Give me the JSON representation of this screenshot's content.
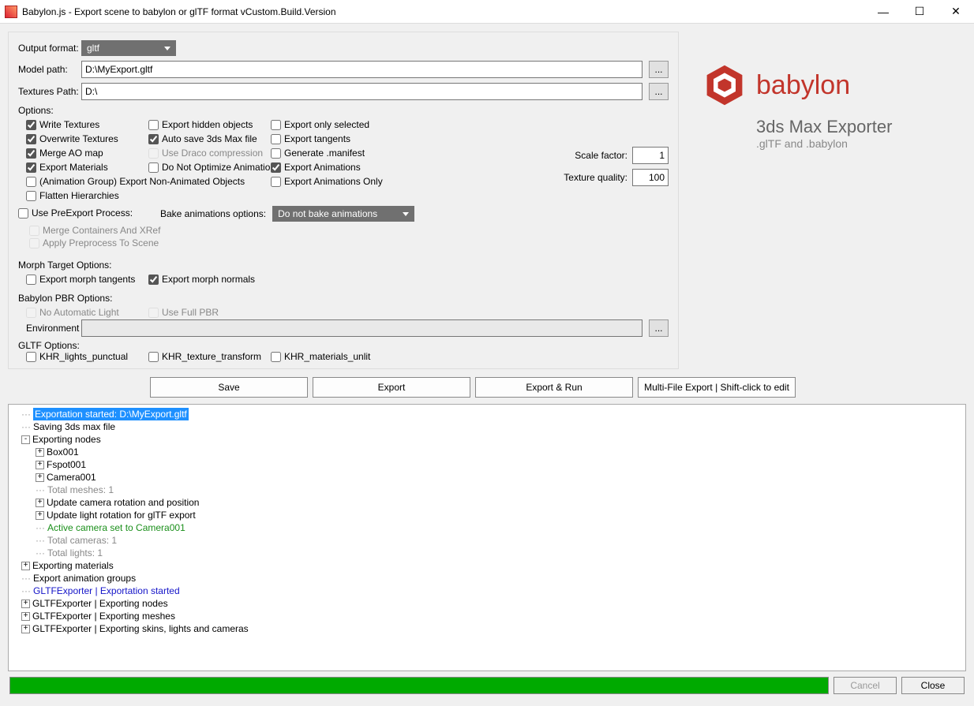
{
  "window": {
    "title": "Babylon.js - Export scene to babylon or glTF format vCustom.Build.Version"
  },
  "labels": {
    "output_format": "Output format:",
    "model_path": "Model path:",
    "textures_path": "Textures Path:",
    "options": "Options:",
    "scale_factor": "Scale factor:",
    "texture_quality": "Texture quality:",
    "bake_anim": "Bake animations options:",
    "morph_header": "Morph Target Options:",
    "pbr_header": "Babylon PBR Options:",
    "environment": "Environment",
    "gltf_header": "GLTF Options:",
    "use_preexport": "Use PreExport Process:"
  },
  "values": {
    "output_format": "gltf",
    "model_path": "D:\\MyExport.gltf",
    "textures_path": "D:\\",
    "scale_factor": "1",
    "texture_quality": "100",
    "bake_anim": "Do not bake animations",
    "environment": ""
  },
  "chk": {
    "write_textures": "Write Textures",
    "overwrite_textures": "Overwrite Textures",
    "merge_ao": "Merge AO map",
    "export_materials": "Export Materials",
    "anim_group": "(Animation Group) Export Non-Animated Objects",
    "flatten": "Flatten Hierarchies",
    "export_hidden": "Export hidden objects",
    "autosave": "Auto save 3ds Max file",
    "draco": "Use Draco compression",
    "nooptim": "Do Not Optimize Animations",
    "only_selected": "Export only selected",
    "export_tangents": "Export tangents",
    "gen_manifest": "Generate .manifest",
    "export_anims": "Export Animations",
    "export_anims_only": "Export Animations Only",
    "merge_containers": "Merge Containers And XRef",
    "apply_preprocess": "Apply Preprocess To Scene",
    "morph_tangents": "Export morph tangents",
    "morph_normals": "Export morph normals",
    "no_auto_light": "No Automatic Light",
    "use_full_pbr": "Use Full PBR",
    "khr_lights": "KHR_lights_punctual",
    "khr_texture": "KHR_texture_transform",
    "khr_unlit": "KHR_materials_unlit"
  },
  "brand": {
    "name": "babylon",
    "sub1": "3ds Max Exporter",
    "sub2": ".glTF and .babylon"
  },
  "buttons": {
    "save": "Save",
    "export": "Export",
    "export_run": "Export & Run",
    "multifile": "Multi-File Export | Shift-click to edit",
    "cancel": "Cancel",
    "close": "Close",
    "browse": "..."
  },
  "log": [
    {
      "indent": 0,
      "exp": "",
      "cls": "sel",
      "text": "Exportation started: D:\\MyExport.gltf"
    },
    {
      "indent": 0,
      "exp": "",
      "cls": "",
      "text": "Saving 3ds max file"
    },
    {
      "indent": 0,
      "exp": "-",
      "cls": "",
      "text": "Exporting nodes"
    },
    {
      "indent": 1,
      "exp": "+",
      "cls": "",
      "text": "Box001"
    },
    {
      "indent": 1,
      "exp": "+",
      "cls": "",
      "text": "Fspot001"
    },
    {
      "indent": 1,
      "exp": "+",
      "cls": "",
      "text": "Camera001"
    },
    {
      "indent": 1,
      "exp": "",
      "cls": "gray",
      "text": "Total meshes: 1"
    },
    {
      "indent": 1,
      "exp": "+",
      "cls": "",
      "text": "Update camera rotation and position"
    },
    {
      "indent": 1,
      "exp": "+",
      "cls": "",
      "text": "Update light rotation for glTF export"
    },
    {
      "indent": 1,
      "exp": "",
      "cls": "green",
      "text": "Active camera set to Camera001"
    },
    {
      "indent": 1,
      "exp": "",
      "cls": "gray",
      "text": "Total cameras: 1"
    },
    {
      "indent": 1,
      "exp": "",
      "cls": "gray",
      "text": "Total lights: 1"
    },
    {
      "indent": 0,
      "exp": "+",
      "cls": "",
      "text": "Exporting materials"
    },
    {
      "indent": 0,
      "exp": "",
      "cls": "",
      "text": "Export animation groups"
    },
    {
      "indent": 0,
      "exp": "",
      "cls": "blue",
      "text": "GLTFExporter | Exportation started"
    },
    {
      "indent": 0,
      "exp": "+",
      "cls": "",
      "text": "GLTFExporter | Exporting nodes"
    },
    {
      "indent": 0,
      "exp": "+",
      "cls": "",
      "text": "GLTFExporter | Exporting meshes"
    },
    {
      "indent": 0,
      "exp": "+",
      "cls": "",
      "text": "GLTFExporter | Exporting skins, lights and cameras"
    }
  ]
}
